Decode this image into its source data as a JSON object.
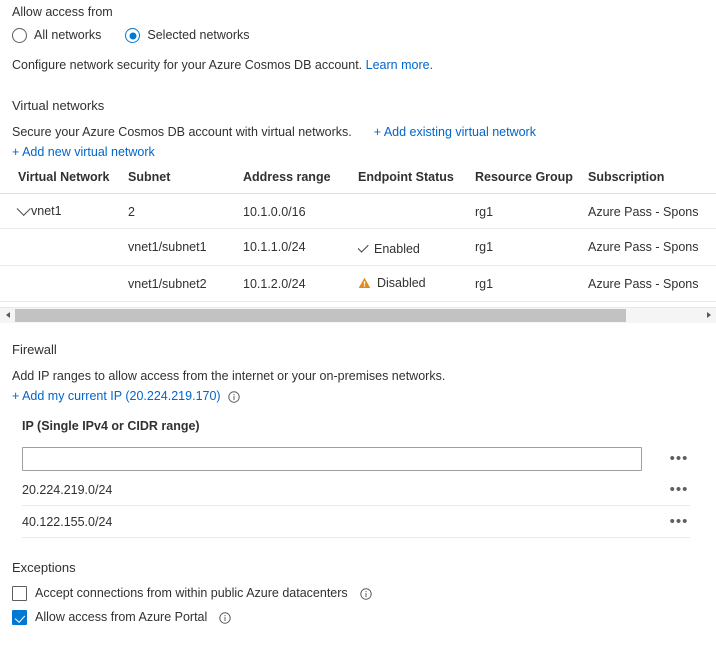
{
  "access": {
    "heading": "Allow access from",
    "options": [
      {
        "label": "All networks",
        "selected": false
      },
      {
        "label": "Selected networks",
        "selected": true
      }
    ],
    "description": "Configure network security for your Azure Cosmos DB account.",
    "learn_more": "Learn more."
  },
  "virtual_networks": {
    "title": "Virtual networks",
    "description": "Secure your Azure Cosmos DB account with virtual networks.",
    "add_existing_link": "+ Add existing virtual network",
    "add_new_link": "+ Add new virtual network",
    "columns": [
      "Virtual Network",
      "Subnet",
      "Address range",
      "Endpoint Status",
      "Resource Group",
      "Subscription"
    ],
    "rows": [
      {
        "virtual_network": "vnet1",
        "expanded": true,
        "subnet": "2",
        "address_range": "10.1.0.0/16",
        "endpoint_status": "",
        "status_icon": "none",
        "resource_group": "rg1",
        "subscription": "Azure Pass - Spons"
      },
      {
        "virtual_network": "",
        "expanded": false,
        "subnet": "vnet1/subnet1",
        "address_range": "10.1.1.0/24",
        "endpoint_status": "Enabled",
        "status_icon": "check",
        "resource_group": "rg1",
        "subscription": "Azure Pass - Spons"
      },
      {
        "virtual_network": "",
        "expanded": false,
        "subnet": "vnet1/subnet2",
        "address_range": "10.1.2.0/24",
        "endpoint_status": "Disabled",
        "status_icon": "warning",
        "resource_group": "rg1",
        "subscription": "Azure Pass - Spons"
      }
    ]
  },
  "firewall": {
    "title": "Firewall",
    "description": "Add IP ranges to allow access from the internet or your on-premises networks.",
    "add_current_ip_link": "+ Add my current IP (20.224.219.170)",
    "ip_field_label": "IP (Single IPv4 or CIDR range)",
    "ip_input_value": "",
    "ip_input_placeholder": "",
    "ip_entries": [
      "20.224.219.0/24",
      "40.122.155.0/24"
    ],
    "row_menu_label": "..."
  },
  "exceptions": {
    "title": "Exceptions",
    "items": [
      {
        "label": "Accept connections from within public Azure datacenters",
        "checked": false
      },
      {
        "label": "Allow access from Azure Portal",
        "checked": true
      }
    ]
  },
  "colors": {
    "accent": "#0078d4",
    "link": "#0066cc",
    "warning": "#e08b1e",
    "text": "#323130",
    "divider": "#edebe9"
  }
}
